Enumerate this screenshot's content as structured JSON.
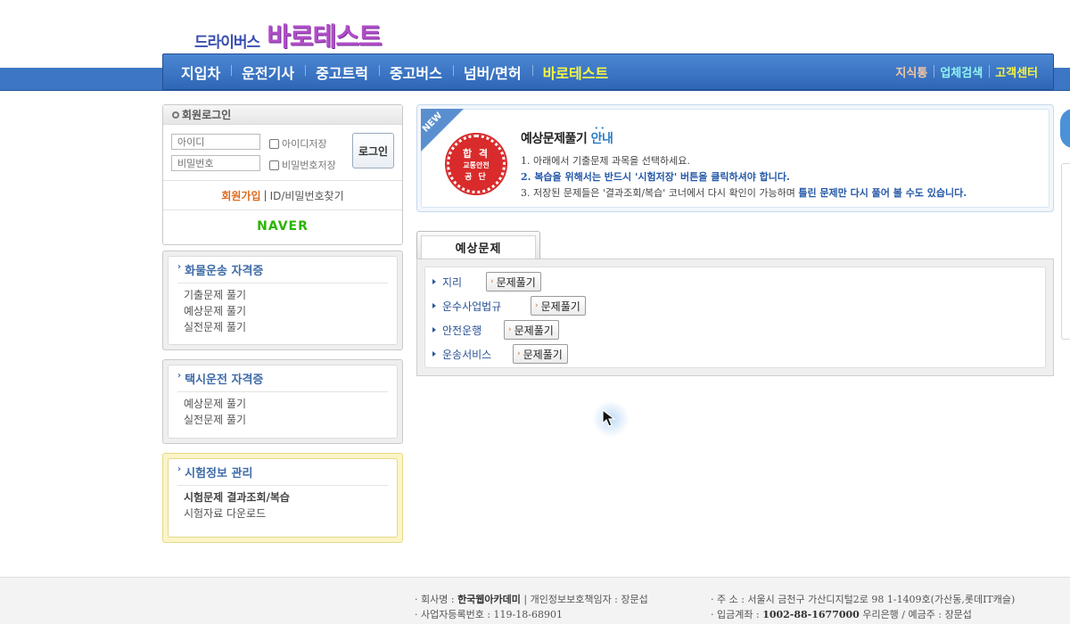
{
  "header": {
    "logo_small": "드라이버스",
    "logo_big": "바로테스트"
  },
  "nav": {
    "items": [
      "지입차",
      "운전기사",
      "중고트럭",
      "중고버스",
      "넘버/면허",
      "바로테스트"
    ],
    "right_items": [
      "지식통",
      "업체검색",
      "고객센터"
    ],
    "highlight_color": "#f7f542"
  },
  "login": {
    "title": "회원로그인",
    "id_placeholder": "아이디",
    "pw_placeholder": "비밀번호",
    "save_id": "아이디저장",
    "save_pw": "비밀번호저장",
    "login_button": "로그인",
    "join": "회원가입",
    "separator": "|",
    "find": "ID/비밀번호찾기",
    "naver": "NAVER"
  },
  "sidebar": {
    "cargo": {
      "title": "화물운송 자격증",
      "links": [
        "기출문제 풀기",
        "예상문제 풀기",
        "실전문제 풀기"
      ]
    },
    "taxi": {
      "title": "택시운전 자격증",
      "links": [
        "예상문제 풀기",
        "실전문제 풀기"
      ]
    },
    "exam_info": {
      "title": "시험정보 관리",
      "links": [
        "시험문제 결과조회/복습",
        "시험자료 다운로드"
      ]
    }
  },
  "banner": {
    "ribbon": "NEW",
    "seal_line1": "합 격",
    "seal_line2": "교통안전",
    "seal_line3": "공 단",
    "title_main": "예상문제풀기 ",
    "title_accent": "안내",
    "line1": "1. 아래에서 기출문제 과목을 선택하세요.",
    "line2": "2. 복습을 위해서는 반드시 '시험저장' 버튼을 클릭하셔야 합니다.",
    "line3_plain": "3. 저장된 문제들은 '결과조회/복습' 코너에서 다시 확인이 가능하며 ",
    "line3_bold": "틀린 문제만 다시 풀어 볼 수도 있습니다."
  },
  "questions": {
    "tab": "예상문제",
    "rows": [
      {
        "label": "지리",
        "button": "문제풀기"
      },
      {
        "label": "운수사업법규",
        "button": "문제풀기"
      },
      {
        "label": "안전운행",
        "button": "문제풀기"
      },
      {
        "label": "운송서비스",
        "button": "문제풀기"
      }
    ]
  },
  "footer": {
    "company_label": "· 회사명 : ",
    "company": "한국웹아카데미",
    "privacy": " | 개인정보보호책임자 : 장문섭",
    "bizno": "· 사업자등록번호 : 119-18-68901",
    "address": "· 주 소 : 서울시 금천구 가산디지털2로 98 1-1409호(가산동,롯데IT캐슬)",
    "account_label": "· 입금계좌 : ",
    "account": "1002-88-1677000",
    "account_rest": " 우리은행 / 예금주 : 장문섭"
  }
}
